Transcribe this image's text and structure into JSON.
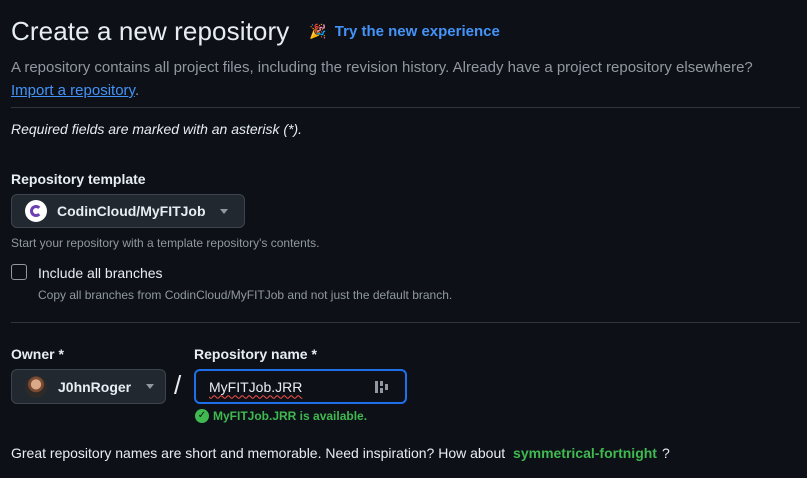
{
  "header": {
    "title": "Create a new repository",
    "try_new": "Try the new experience",
    "description": "A repository contains all project files, including the revision history. Already have a project repository elsewhere?",
    "import_link": "Import a repository",
    "import_suffix": "."
  },
  "required_note": "Required fields are marked with an asterisk (*).",
  "template": {
    "label": "Repository template",
    "selected": "CodinCloud/MyFITJob",
    "hint": "Start your repository with a template repository's contents.",
    "include_branches_label": "Include all branches",
    "include_branches_checked": false,
    "include_branches_hint": "Copy all branches from CodinCloud/MyFITJob and not just the default branch."
  },
  "owner": {
    "label": "Owner *",
    "selected": "J0hnRoger"
  },
  "separator": "/",
  "repo_name": {
    "label": "Repository name *",
    "value": "MyFITJob.JRR",
    "available_text": "MyFITJob.JRR is available."
  },
  "inspiration": {
    "prefix": "Great repository names are short and memorable. Need inspiration? How about",
    "suggestion": "symmetrical-fortnight",
    "suffix": "?"
  },
  "icons": {
    "try_new": "party-popper-icon",
    "template_avatar": "org-avatar",
    "owner_avatar": "user-avatar",
    "input_tool": "password-manager-icon",
    "available": "check-circle-icon"
  },
  "colors": {
    "background": "#0d1117",
    "accent_link": "#4493f8",
    "success": "#3fb950",
    "focus_border": "#1f6feb"
  }
}
